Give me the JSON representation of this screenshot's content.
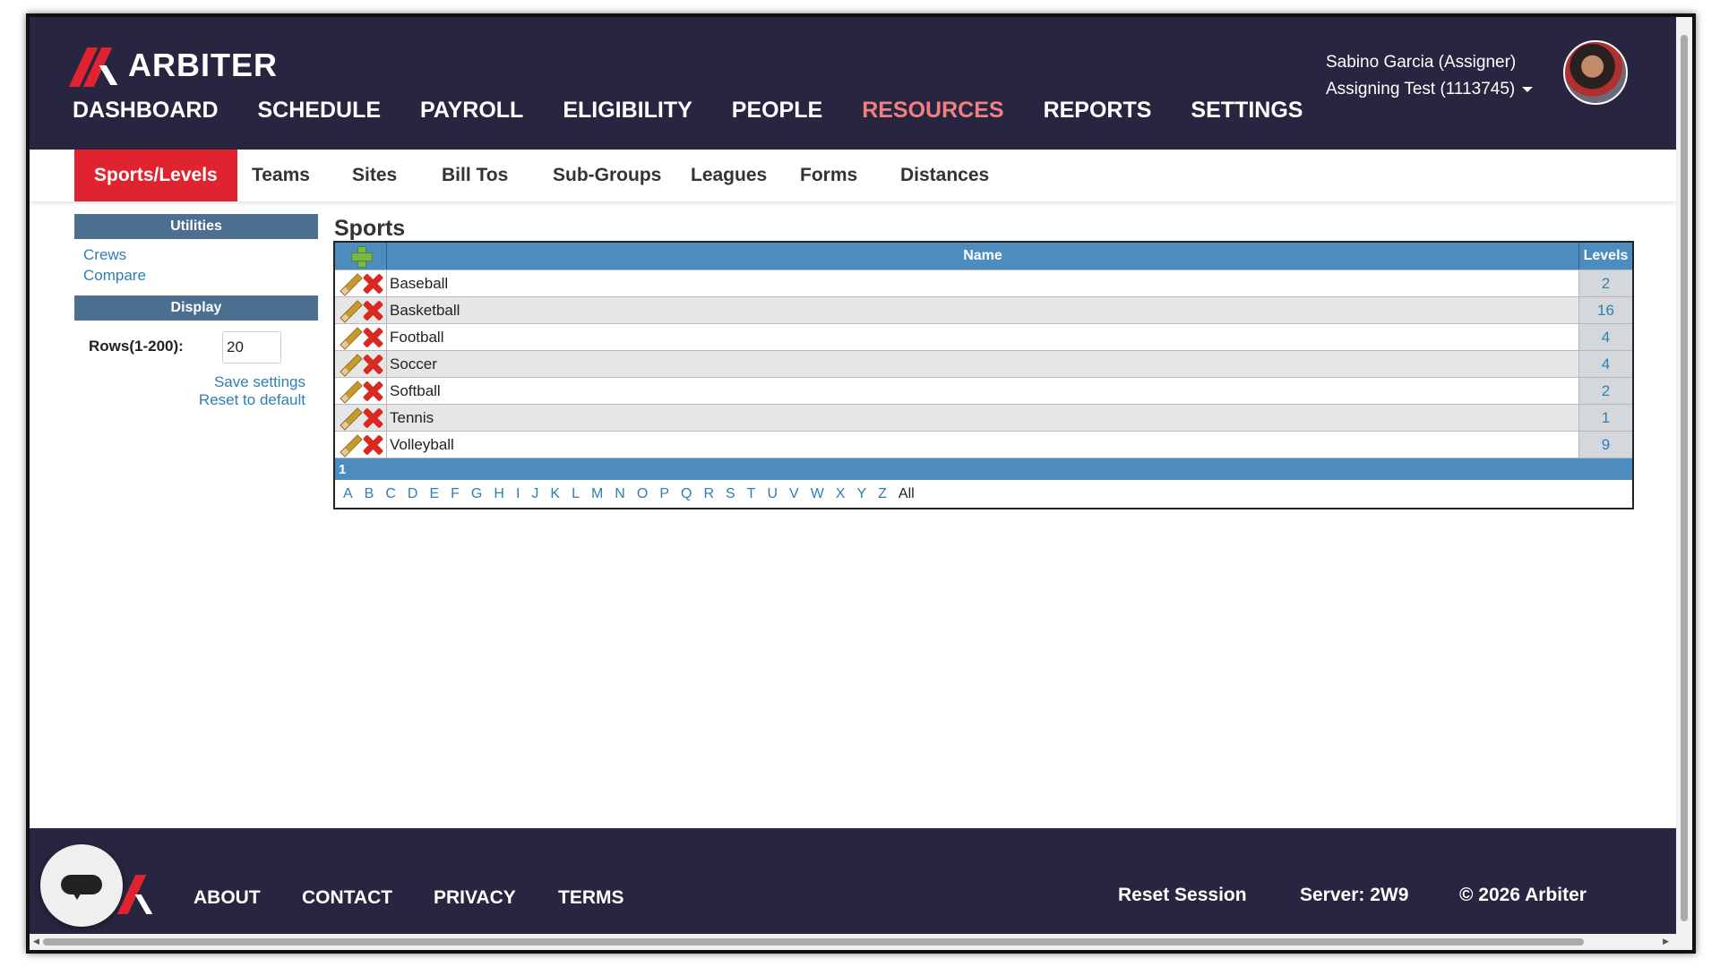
{
  "header": {
    "logo_text": "ARBITER",
    "nav": [
      {
        "label": "DASHBOARD",
        "active": false
      },
      {
        "label": "SCHEDULE",
        "active": false
      },
      {
        "label": "PAYROLL",
        "active": false
      },
      {
        "label": "ELIGIBILITY",
        "active": false
      },
      {
        "label": "PEOPLE",
        "active": false
      },
      {
        "label": "RESOURCES",
        "active": true
      },
      {
        "label": "REPORTS",
        "active": false
      },
      {
        "label": "SETTINGS",
        "active": false
      }
    ],
    "user_name": "Sabino Garcia (Assigner)",
    "group": "Assigning Test (1113745)"
  },
  "subnav": [
    {
      "label": "Sports/Levels",
      "active": true
    },
    {
      "label": "Teams"
    },
    {
      "label": "Sites"
    },
    {
      "label": "Bill Tos"
    },
    {
      "label": "Sub-Groups"
    },
    {
      "label": "Leagues"
    },
    {
      "label": "Forms"
    },
    {
      "label": "Distances"
    }
  ],
  "sidebar": {
    "utilities_title": "Utilities",
    "utilities_links": [
      "Crews",
      "Compare"
    ],
    "display_title": "Display",
    "rows_label": "Rows(1-200):",
    "rows_value": "20",
    "save_settings": "Save settings",
    "reset_default": "Reset to default"
  },
  "sports": {
    "title": "Sports",
    "col_name": "Name",
    "col_levels": "Levels",
    "rows": [
      {
        "name": "Baseball",
        "levels": "2"
      },
      {
        "name": "Basketball",
        "levels": "16"
      },
      {
        "name": "Football",
        "levels": "4"
      },
      {
        "name": "Soccer",
        "levels": "4"
      },
      {
        "name": "Softball",
        "levels": "2"
      },
      {
        "name": "Tennis",
        "levels": "1"
      },
      {
        "name": "Volleyball",
        "levels": "9"
      }
    ],
    "page": "1",
    "alpha": [
      "A",
      "B",
      "C",
      "D",
      "E",
      "F",
      "G",
      "H",
      "I",
      "J",
      "K",
      "L",
      "M",
      "N",
      "O",
      "P",
      "Q",
      "R",
      "S",
      "T",
      "U",
      "V",
      "W",
      "X",
      "Y",
      "Z"
    ],
    "alpha_all": "All"
  },
  "footer": {
    "links": [
      "ABOUT",
      "CONTACT",
      "PRIVACY",
      "TERMS"
    ],
    "reset_session": "Reset Session",
    "server": "Server: 2W9",
    "copyright": "© 2026 Arbiter"
  },
  "colors": {
    "header_bg": "#27253f",
    "accent_red": "#e0242f",
    "table_blue": "#4c8cbf",
    "sidebar_header": "#4c6e8f",
    "link_blue": "#2f7fb0"
  }
}
